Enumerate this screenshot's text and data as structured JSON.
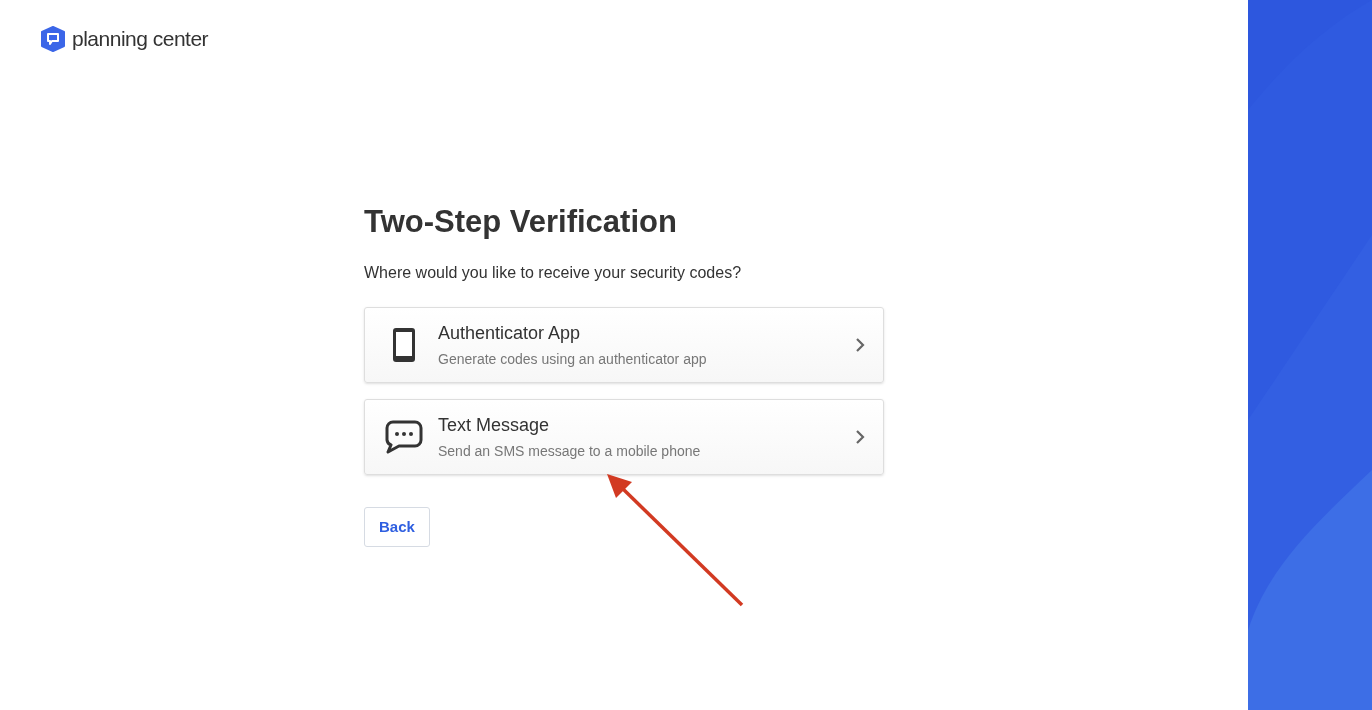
{
  "logo": {
    "text": "planning center"
  },
  "title": "Two-Step Verification",
  "prompt": "Where would you like to receive your security codes?",
  "options": [
    {
      "kind": "phone",
      "title": "Authenticator App",
      "description": "Generate codes using an authenticator app"
    },
    {
      "kind": "chat",
      "title": "Text Message",
      "description": "Send an SMS message to a mobile phone"
    }
  ],
  "back_button": "Back",
  "annotation": {
    "kind": "arrow"
  }
}
